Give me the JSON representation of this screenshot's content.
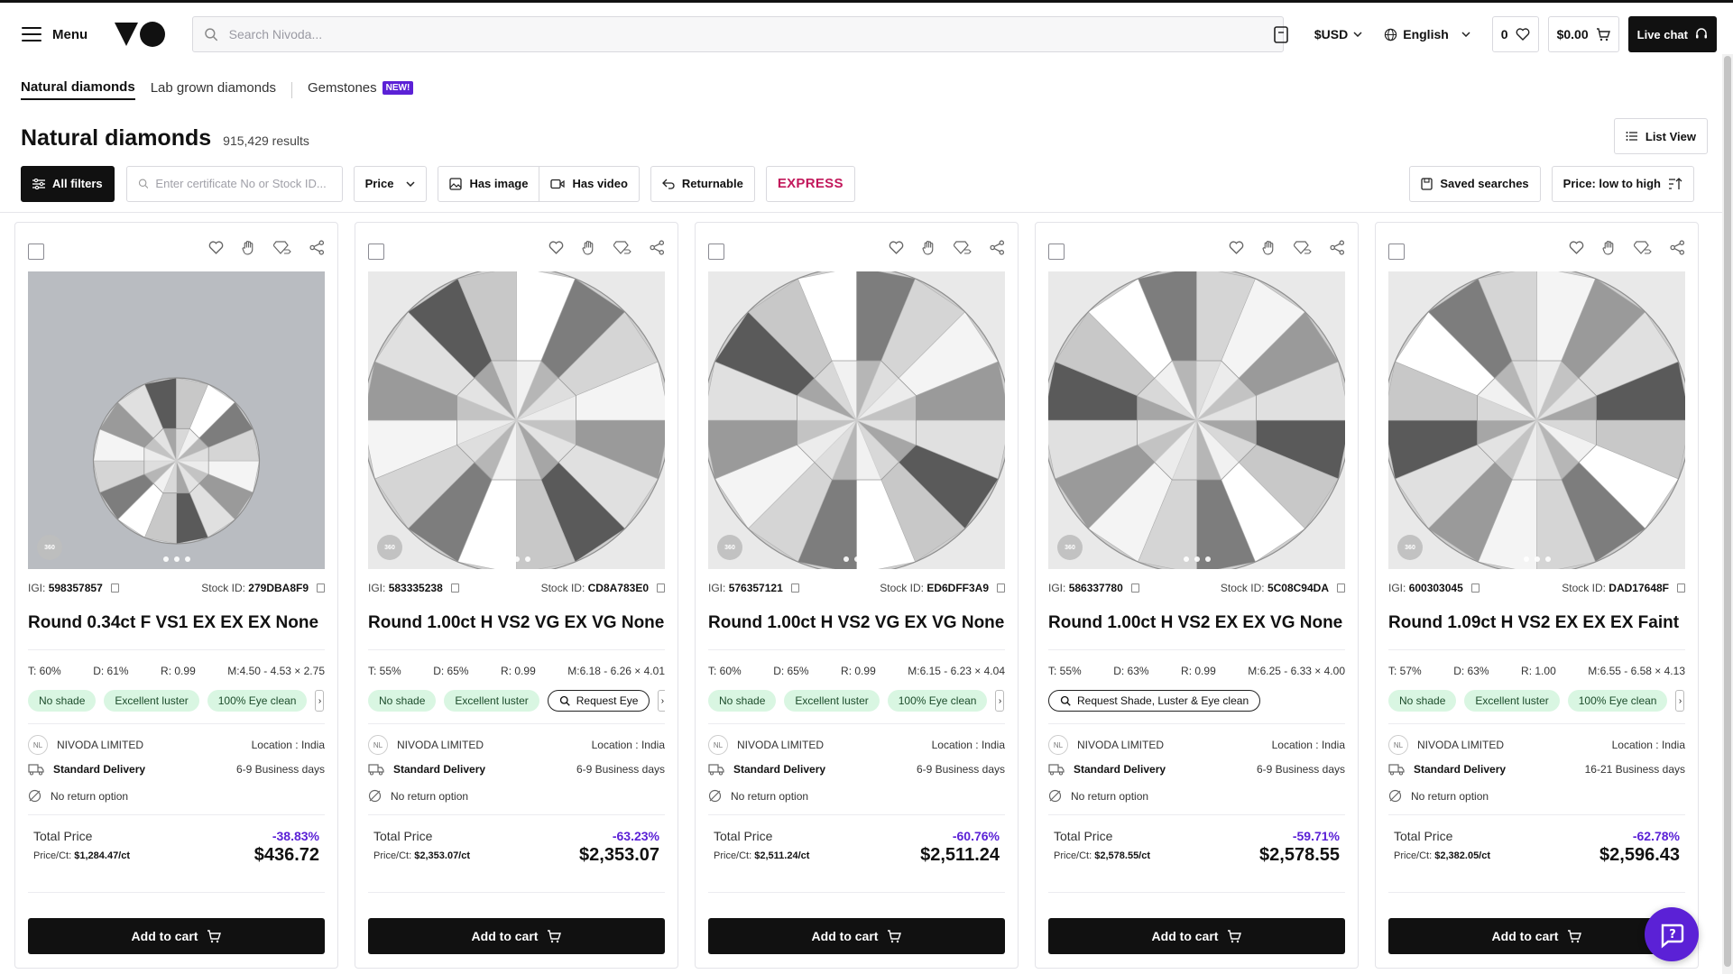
{
  "header": {
    "menu_label": "Menu",
    "search_placeholder": "Search Nivoda...",
    "currency": "$USD",
    "language": "English",
    "wishlist_count": "0",
    "cart_total": "$0.00",
    "live_chat": "Live chat"
  },
  "tabs": [
    {
      "label": "Natural diamonds"
    },
    {
      "label": "Lab grown diamonds"
    },
    {
      "label": "Gemstones",
      "badge": "NEW!"
    }
  ],
  "page": {
    "title": "Natural diamonds",
    "results": "915,429 results",
    "list_view": "List View"
  },
  "filters": {
    "all_filters": "All filters",
    "cert_placeholder": "Enter certificate No or Stock ID...",
    "price": "Price",
    "has_image": "Has image",
    "has_video": "Has video",
    "returnable": "Returnable",
    "express": "EXPRESS",
    "saved_searches": "Saved searches",
    "sort": "Price: low to high"
  },
  "cards": [
    {
      "igi_label": "IGI:",
      "igi": "598357857",
      "stock_label": "Stock ID:",
      "stock": "279DBA8F9",
      "title": "Round 0.34ct F VS1 EX EX EX None",
      "t": "T: 60%",
      "d": "D: 61%",
      "r": "R: 0.99",
      "m": "M:4.50 - 4.53 × 2.75",
      "chips": [
        "No shade",
        "Excellent luster",
        "100% Eye clean"
      ],
      "supplier": "NIVODA LIMITED",
      "location": "Location : India",
      "delivery": "Standard Delivery",
      "delivery_days": "6-9 Business days",
      "return": "No return option",
      "total_label": "Total Price",
      "discount": "-38.83%",
      "price_ct_label": "Price/Ct:",
      "price_ct": "$1,284.47/ct",
      "total": "$436.72",
      "cart": "Add to cart"
    },
    {
      "igi_label": "IGI:",
      "igi": "583335238",
      "stock_label": "Stock ID:",
      "stock": "CD8A783E0",
      "title": "Round 1.00ct H VS2 VG EX VG None",
      "t": "T: 55%",
      "d": "D: 65%",
      "r": "R: 0.99",
      "m": "M:6.18 - 6.26 × 4.01",
      "chips": [
        "No shade",
        "Excellent luster"
      ],
      "request_chip": "Request Eye",
      "supplier": "NIVODA LIMITED",
      "location": "Location : India",
      "delivery": "Standard Delivery",
      "delivery_days": "6-9 Business days",
      "return": "No return option",
      "total_label": "Total Price",
      "discount": "-63.23%",
      "price_ct_label": "Price/Ct:",
      "price_ct": "$2,353.07/ct",
      "total": "$2,353.07",
      "cart": "Add to cart"
    },
    {
      "igi_label": "IGI:",
      "igi": "576357121",
      "stock_label": "Stock ID:",
      "stock": "ED6DFF3A9",
      "title": "Round 1.00ct H VS2 VG EX VG None",
      "t": "T: 60%",
      "d": "D: 65%",
      "r": "R: 0.99",
      "m": "M:6.15 - 6.23 × 4.04",
      "chips": [
        "No shade",
        "Excellent luster",
        "100% Eye clean"
      ],
      "supplier": "NIVODA LIMITED",
      "location": "Location : India",
      "delivery": "Standard Delivery",
      "delivery_days": "6-9 Business days",
      "return": "No return option",
      "total_label": "Total Price",
      "discount": "-60.76%",
      "price_ct_label": "Price/Ct:",
      "price_ct": "$2,511.24/ct",
      "total": "$2,511.24",
      "cart": "Add to cart"
    },
    {
      "igi_label": "IGI:",
      "igi": "586337780",
      "stock_label": "Stock ID:",
      "stock": "5C08C94DA",
      "title": "Round 1.00ct H VS2 EX EX VG None",
      "t": "T: 55%",
      "d": "D: 63%",
      "r": "R: 0.99",
      "m": "M:6.25 - 6.33 × 4.00",
      "chips": [],
      "request_chip": "Request Shade, Luster & Eye clean",
      "supplier": "NIVODA LIMITED",
      "location": "Location : India",
      "delivery": "Standard Delivery",
      "delivery_days": "6-9 Business days",
      "return": "No return option",
      "total_label": "Total Price",
      "discount": "-59.71%",
      "price_ct_label": "Price/Ct:",
      "price_ct": "$2,578.55/ct",
      "total": "$2,578.55",
      "cart": "Add to cart"
    },
    {
      "igi_label": "IGI:",
      "igi": "600303045",
      "stock_label": "Stock ID:",
      "stock": "DAD17648F",
      "title": "Round 1.09ct H VS2 EX EX EX Faint",
      "t": "T: 57%",
      "d": "D: 63%",
      "r": "R: 1.00",
      "m": "M:6.55 - 6.58 × 4.13",
      "chips": [
        "No shade",
        "Excellent luster",
        "100% Eye clean"
      ],
      "supplier": "NIVODA LIMITED",
      "location": "Location : India",
      "delivery": "Standard Delivery",
      "delivery_days": "16-21 Business days",
      "return": "No return option",
      "total_label": "Total Price",
      "discount": "-62.78%",
      "price_ct_label": "Price/Ct:",
      "price_ct": "$2,382.05/ct",
      "total": "$2,596.43",
      "cart": "Add to cart"
    }
  ],
  "image_badge": "360",
  "supplier_initials": "NL",
  "colors": {
    "accent": "#5b21d6",
    "express": "#c2185b",
    "chip_bg": "#d9f6e2"
  }
}
